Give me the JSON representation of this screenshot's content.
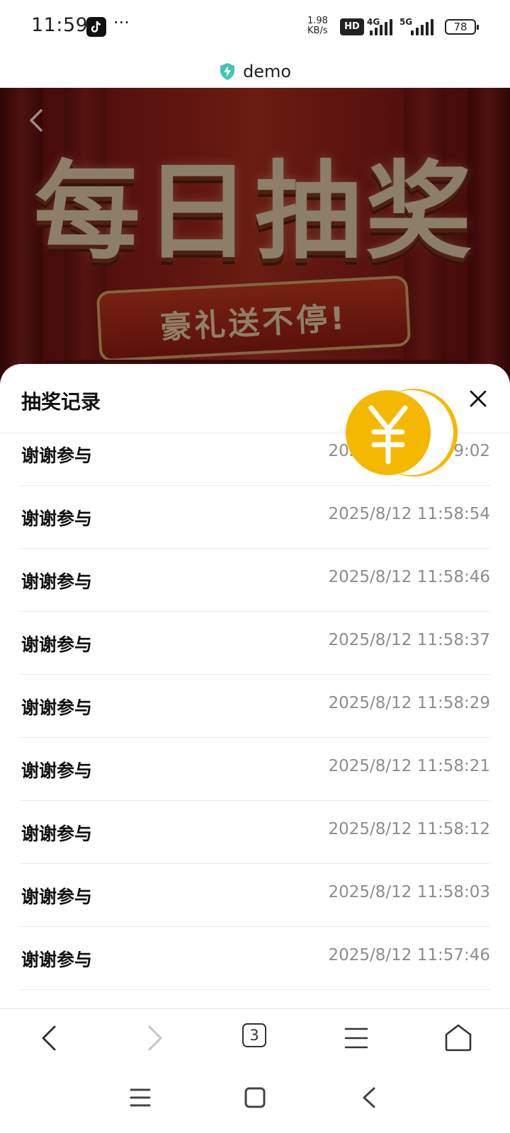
{
  "status_bar": {
    "time": "11:59",
    "more": "···",
    "net_speed_value": "1.98",
    "net_speed_unit": "KB/s",
    "hd": "HD",
    "net1": "4G",
    "net2": "5G",
    "battery": "78"
  },
  "url_bar": {
    "domain": "demo",
    "icon": "shield-bolt-icon"
  },
  "hero": {
    "title": "每日抽奖",
    "subtitle": "豪礼送不停!"
  },
  "sheet": {
    "title": "抽奖记录",
    "records": [
      {
        "label": "谢谢参与",
        "time": "2025/8/12 11:59:02"
      },
      {
        "label": "谢谢参与",
        "time": "2025/8/12 11:58:54"
      },
      {
        "label": "谢谢参与",
        "time": "2025/8/12 11:58:46"
      },
      {
        "label": "谢谢参与",
        "time": "2025/8/12 11:58:37"
      },
      {
        "label": "谢谢参与",
        "time": "2025/8/12 11:58:29"
      },
      {
        "label": "谢谢参与",
        "time": "2025/8/12 11:58:21"
      },
      {
        "label": "谢谢参与",
        "time": "2025/8/12 11:58:12"
      },
      {
        "label": "谢谢参与",
        "time": "2025/8/12 11:58:03"
      },
      {
        "label": "谢谢参与",
        "time": "2025/8/12 11:57:46"
      }
    ]
  },
  "coin": {
    "symbol": "¥",
    "color": "#F5B800"
  },
  "browser_bar": {
    "tab_count": "3"
  },
  "colors": {
    "accent": "#F5B800",
    "hero_red": "#B5321F",
    "muted_text": "#8C8C8C"
  }
}
